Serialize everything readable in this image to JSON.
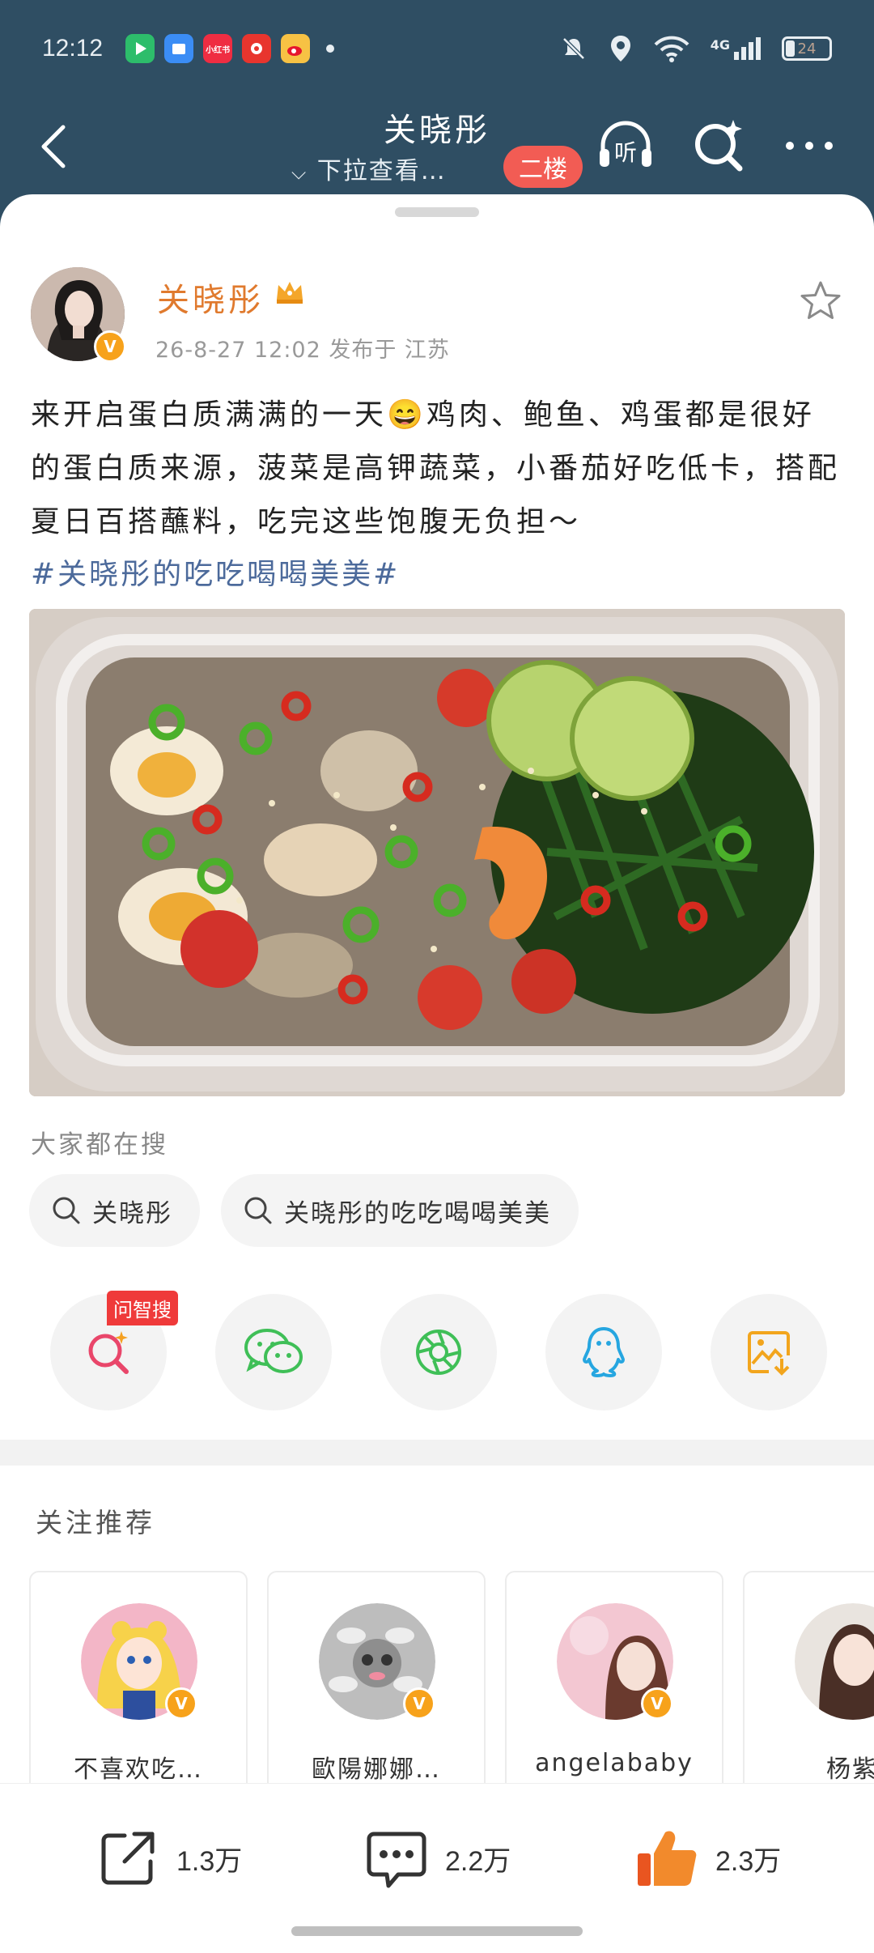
{
  "status_bar": {
    "time": "12:12",
    "apps": [
      {
        "icon": "game-app-icon",
        "color": "#2dbd6b",
        "label": ""
      },
      {
        "icon": "files-app-icon",
        "color": "#3b8df5",
        "label": ""
      },
      {
        "icon": "xiaohongshu-app-icon",
        "color": "#ef2d42",
        "label": "小红书"
      },
      {
        "icon": "pinduoduo-app-icon",
        "color": "#e8352e",
        "label": ""
      },
      {
        "icon": "weibo-app-icon",
        "color": "#f7c244",
        "label": ""
      }
    ],
    "network": "4G",
    "battery": "24"
  },
  "nav": {
    "title": "关晓彤",
    "subtitle": "下拉查看…",
    "floor_badge": "二楼",
    "listen_label": "听"
  },
  "post": {
    "author_name": "关晓彤",
    "meta": "26-8-27 12:02  发布于 江苏",
    "text": "来开启蛋白质满满的一天😄鸡肉、鲍鱼、鸡蛋都是很好的蛋白质来源，菠菜是高钾蔬菜，小番茄好吃低卡，搭配夏日百搭蘸料，吃完这些饱腹无负担～",
    "hashtag": "#关晓彤的吃吃喝喝美美#"
  },
  "search": {
    "title": "大家都在搜",
    "chips": [
      "关晓彤",
      "关晓彤的吃吃喝喝美美"
    ]
  },
  "share": {
    "ai_tag": "问智搜",
    "buttons": [
      "ai-search",
      "wechat",
      "moments",
      "qq",
      "save-image"
    ]
  },
  "recommend": {
    "title": "关注推荐",
    "users": [
      {
        "name": "不喜欢吃…"
      },
      {
        "name": "歐陽娜娜…"
      },
      {
        "name": "angelababy"
      },
      {
        "name": "杨紫"
      }
    ]
  },
  "actions": {
    "share_count": "1.3万",
    "comment_count": "2.2万",
    "like_count": "2.3万"
  },
  "colors": {
    "header_bg": "#2f4e63",
    "author_orange": "#e07a2e",
    "hashtag_blue": "#4c6a9b",
    "verified": "#f7a21b",
    "floor_red": "#f25c54"
  }
}
